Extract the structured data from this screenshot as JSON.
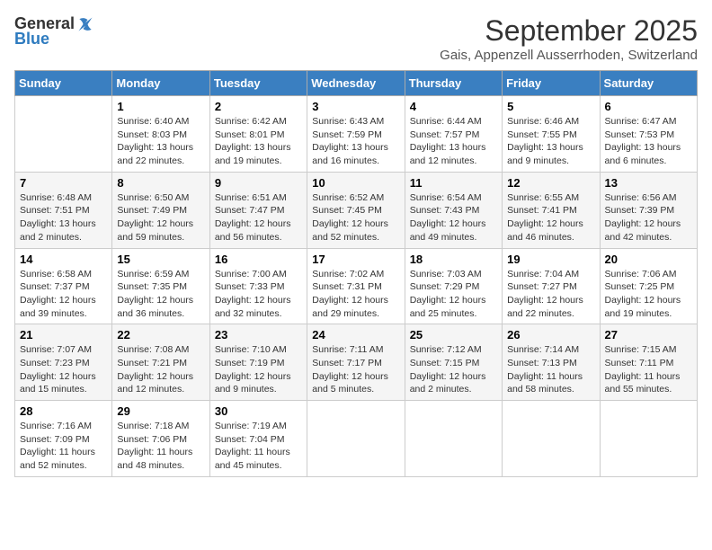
{
  "logo": {
    "text_general": "General",
    "text_blue": "Blue"
  },
  "title": "September 2025",
  "subtitle": "Gais, Appenzell Ausserrhoden, Switzerland",
  "days_header": [
    "Sunday",
    "Monday",
    "Tuesday",
    "Wednesday",
    "Thursday",
    "Friday",
    "Saturday"
  ],
  "weeks": [
    [
      {
        "day": "",
        "info": ""
      },
      {
        "day": "1",
        "info": "Sunrise: 6:40 AM\nSunset: 8:03 PM\nDaylight: 13 hours\nand 22 minutes."
      },
      {
        "day": "2",
        "info": "Sunrise: 6:42 AM\nSunset: 8:01 PM\nDaylight: 13 hours\nand 19 minutes."
      },
      {
        "day": "3",
        "info": "Sunrise: 6:43 AM\nSunset: 7:59 PM\nDaylight: 13 hours\nand 16 minutes."
      },
      {
        "day": "4",
        "info": "Sunrise: 6:44 AM\nSunset: 7:57 PM\nDaylight: 13 hours\nand 12 minutes."
      },
      {
        "day": "5",
        "info": "Sunrise: 6:46 AM\nSunset: 7:55 PM\nDaylight: 13 hours\nand 9 minutes."
      },
      {
        "day": "6",
        "info": "Sunrise: 6:47 AM\nSunset: 7:53 PM\nDaylight: 13 hours\nand 6 minutes."
      }
    ],
    [
      {
        "day": "7",
        "info": "Sunrise: 6:48 AM\nSunset: 7:51 PM\nDaylight: 13 hours\nand 2 minutes."
      },
      {
        "day": "8",
        "info": "Sunrise: 6:50 AM\nSunset: 7:49 PM\nDaylight: 12 hours\nand 59 minutes."
      },
      {
        "day": "9",
        "info": "Sunrise: 6:51 AM\nSunset: 7:47 PM\nDaylight: 12 hours\nand 56 minutes."
      },
      {
        "day": "10",
        "info": "Sunrise: 6:52 AM\nSunset: 7:45 PM\nDaylight: 12 hours\nand 52 minutes."
      },
      {
        "day": "11",
        "info": "Sunrise: 6:54 AM\nSunset: 7:43 PM\nDaylight: 12 hours\nand 49 minutes."
      },
      {
        "day": "12",
        "info": "Sunrise: 6:55 AM\nSunset: 7:41 PM\nDaylight: 12 hours\nand 46 minutes."
      },
      {
        "day": "13",
        "info": "Sunrise: 6:56 AM\nSunset: 7:39 PM\nDaylight: 12 hours\nand 42 minutes."
      }
    ],
    [
      {
        "day": "14",
        "info": "Sunrise: 6:58 AM\nSunset: 7:37 PM\nDaylight: 12 hours\nand 39 minutes."
      },
      {
        "day": "15",
        "info": "Sunrise: 6:59 AM\nSunset: 7:35 PM\nDaylight: 12 hours\nand 36 minutes."
      },
      {
        "day": "16",
        "info": "Sunrise: 7:00 AM\nSunset: 7:33 PM\nDaylight: 12 hours\nand 32 minutes."
      },
      {
        "day": "17",
        "info": "Sunrise: 7:02 AM\nSunset: 7:31 PM\nDaylight: 12 hours\nand 29 minutes."
      },
      {
        "day": "18",
        "info": "Sunrise: 7:03 AM\nSunset: 7:29 PM\nDaylight: 12 hours\nand 25 minutes."
      },
      {
        "day": "19",
        "info": "Sunrise: 7:04 AM\nSunset: 7:27 PM\nDaylight: 12 hours\nand 22 minutes."
      },
      {
        "day": "20",
        "info": "Sunrise: 7:06 AM\nSunset: 7:25 PM\nDaylight: 12 hours\nand 19 minutes."
      }
    ],
    [
      {
        "day": "21",
        "info": "Sunrise: 7:07 AM\nSunset: 7:23 PM\nDaylight: 12 hours\nand 15 minutes."
      },
      {
        "day": "22",
        "info": "Sunrise: 7:08 AM\nSunset: 7:21 PM\nDaylight: 12 hours\nand 12 minutes."
      },
      {
        "day": "23",
        "info": "Sunrise: 7:10 AM\nSunset: 7:19 PM\nDaylight: 12 hours\nand 9 minutes."
      },
      {
        "day": "24",
        "info": "Sunrise: 7:11 AM\nSunset: 7:17 PM\nDaylight: 12 hours\nand 5 minutes."
      },
      {
        "day": "25",
        "info": "Sunrise: 7:12 AM\nSunset: 7:15 PM\nDaylight: 12 hours\nand 2 minutes."
      },
      {
        "day": "26",
        "info": "Sunrise: 7:14 AM\nSunset: 7:13 PM\nDaylight: 11 hours\nand 58 minutes."
      },
      {
        "day": "27",
        "info": "Sunrise: 7:15 AM\nSunset: 7:11 PM\nDaylight: 11 hours\nand 55 minutes."
      }
    ],
    [
      {
        "day": "28",
        "info": "Sunrise: 7:16 AM\nSunset: 7:09 PM\nDaylight: 11 hours\nand 52 minutes."
      },
      {
        "day": "29",
        "info": "Sunrise: 7:18 AM\nSunset: 7:06 PM\nDaylight: 11 hours\nand 48 minutes."
      },
      {
        "day": "30",
        "info": "Sunrise: 7:19 AM\nSunset: 7:04 PM\nDaylight: 11 hours\nand 45 minutes."
      },
      {
        "day": "",
        "info": ""
      },
      {
        "day": "",
        "info": ""
      },
      {
        "day": "",
        "info": ""
      },
      {
        "day": "",
        "info": ""
      }
    ]
  ]
}
